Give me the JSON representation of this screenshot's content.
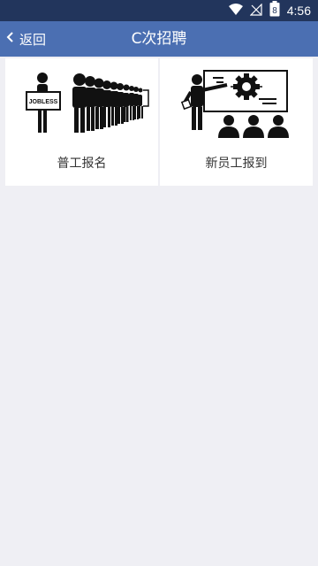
{
  "status": {
    "time": "4:56",
    "battery": "8"
  },
  "header": {
    "back_label": "返回",
    "title": "C次招聘"
  },
  "cards": [
    {
      "label": "普工报名",
      "sign_text": "JOBLESS"
    },
    {
      "label": "新员工报到"
    }
  ]
}
